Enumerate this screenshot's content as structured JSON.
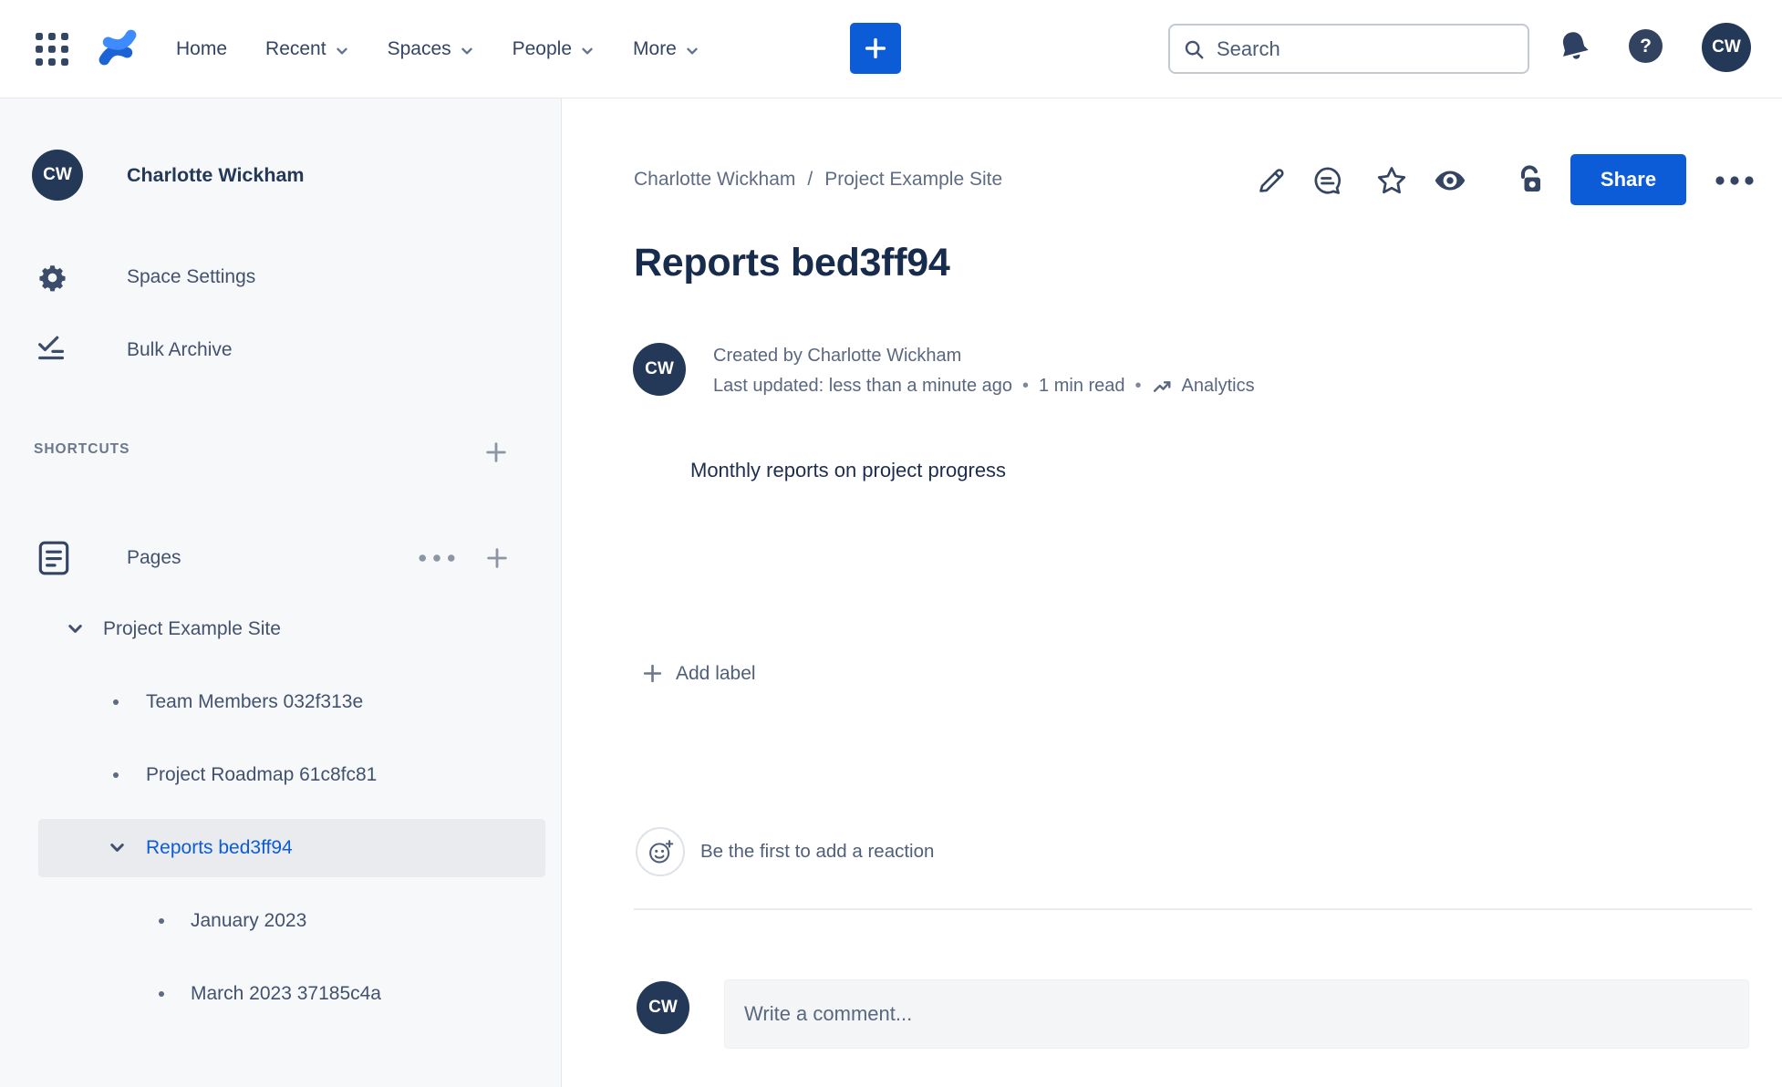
{
  "topbar": {
    "nav_items": [
      {
        "label": "Home",
        "has_dropdown": false
      },
      {
        "label": "Recent",
        "has_dropdown": true
      },
      {
        "label": "Spaces",
        "has_dropdown": true
      },
      {
        "label": "People",
        "has_dropdown": true
      },
      {
        "label": "More",
        "has_dropdown": true
      }
    ],
    "search": {
      "placeholder": "Search"
    },
    "help_glyph": "?",
    "avatar_initials": "CW"
  },
  "sidebar": {
    "space_avatar_initials": "CW",
    "space_name": "Charlotte Wickham",
    "menu_items": [
      {
        "label": "Space Settings",
        "icon": "gear-icon"
      },
      {
        "label": "Bulk Archive",
        "icon": "bulk-archive-icon"
      }
    ],
    "shortcuts_header": "SHORTCUTS",
    "pages_label": "Pages",
    "tree": [
      {
        "label": "Project Example Site",
        "level": 1,
        "expanded": true,
        "selected": false
      },
      {
        "label": "Team Members 032f313e",
        "level": 2,
        "expanded": false,
        "selected": false
      },
      {
        "label": "Project Roadmap 61c8fc81",
        "level": 2,
        "expanded": false,
        "selected": false
      },
      {
        "label": "Reports bed3ff94",
        "level": 2,
        "expanded": true,
        "selected": true
      },
      {
        "label": "January 2023",
        "level": 3,
        "expanded": false,
        "selected": false
      },
      {
        "label": "March 2023 37185c4a",
        "level": 3,
        "expanded": false,
        "selected": false
      }
    ]
  },
  "main": {
    "breadcrumbs": [
      {
        "label": "Charlotte Wickham"
      },
      {
        "label": "Project Example Site"
      }
    ],
    "breadcrumb_separator": "/",
    "share_label": "Share",
    "page_title": "Reports bed3ff94",
    "byline": {
      "avatar_initials": "CW",
      "created_line": "Created by Charlotte Wickham",
      "updated_line": "Last updated: less than a minute ago",
      "separator": "•",
      "read_time": "1 min read",
      "analytics_label": "Analytics"
    },
    "body_text": "Monthly reports on project progress",
    "add_label_text": "Add label",
    "reaction_prompt": "Be the first to add a reaction",
    "comment": {
      "avatar_initials": "CW",
      "placeholder": "Write a comment..."
    }
  },
  "colors": {
    "accent_blue": "#0C5CD7",
    "link_blue": "#0C5CD7",
    "title_navy": "#172B4D",
    "icon_navy": "#344563",
    "muted_text": "#5E6C84",
    "sidebar_bg": "#F7F8F9",
    "selected_row_bg": "#E9EBEE",
    "avatar_bg": "#243858",
    "divider": "#EBECF0",
    "comment_box_bg": "#F4F5F7",
    "logo_blue_light": "#3E8BFF",
    "logo_blue_dark": "#1C63D6"
  }
}
